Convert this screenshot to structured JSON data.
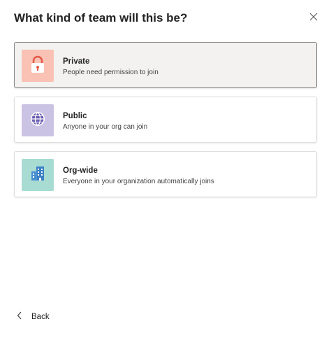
{
  "dialog": {
    "title": "What kind of team will this be?"
  },
  "options": [
    {
      "name": "Private",
      "description": "People need permission to join",
      "icon": "lock-icon",
      "tile_color": "#f9c2b4",
      "icon_color": "#e25c4b",
      "selected": true
    },
    {
      "name": "Public",
      "description": "Anyone in your org can join",
      "icon": "globe-icon",
      "tile_color": "#cbc3e3",
      "icon_color": "#6b5fb0",
      "selected": false
    },
    {
      "name": "Org-wide",
      "description": "Everyone in your organization automatically joins",
      "icon": "building-icon",
      "tile_color": "#a8dbd2",
      "icon_color": "#3b7fc4",
      "selected": false
    }
  ],
  "footer": {
    "back_label": "Back"
  }
}
